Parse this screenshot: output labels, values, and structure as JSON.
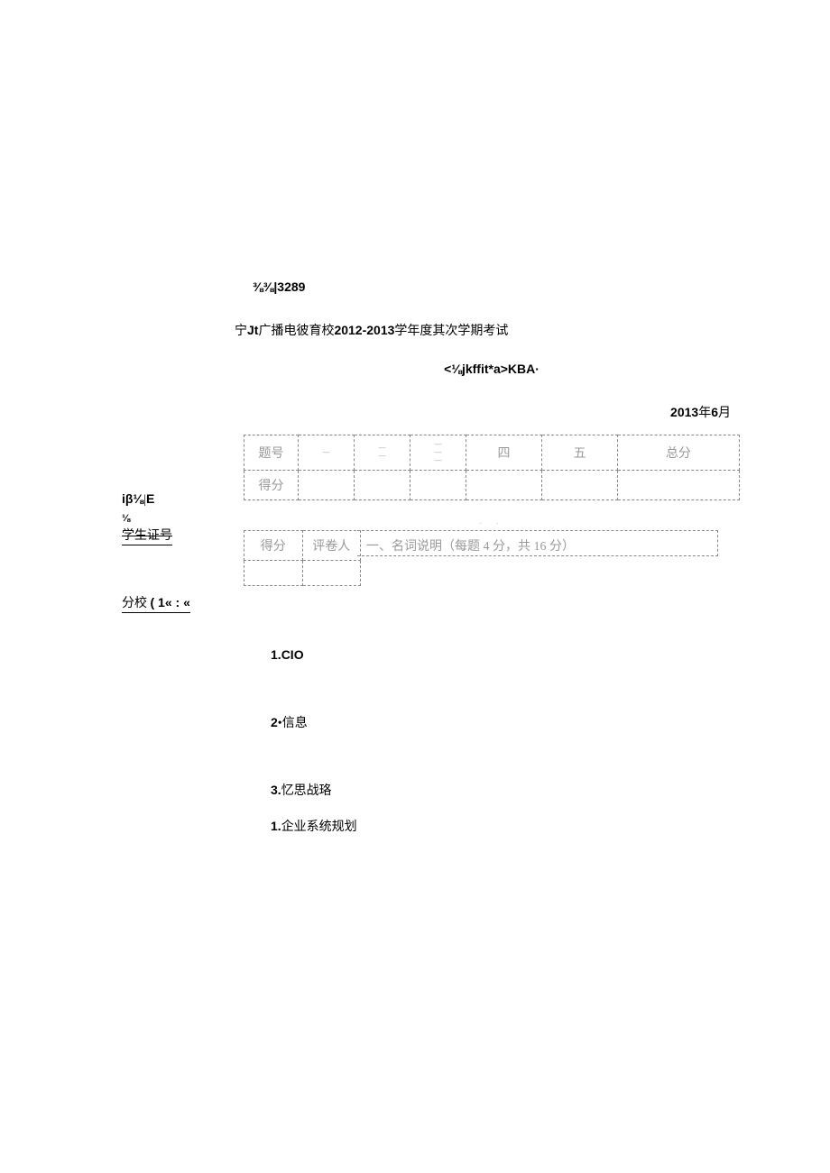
{
  "sidebar": {
    "code_label": "iβ⅛",
    "code_sep": "|",
    "code_suffix": "E",
    "underline_mark": "⅛",
    "student_id_label": "学生证号",
    "branch_label": "分校",
    "branch_paren": "( 1« : «"
  },
  "header": {
    "course_prefix": "⅜⅜",
    "course_sep": "|",
    "course_code": "3289",
    "title_prefix": "宁",
    "title_bold": "Jt",
    "title_mid": "广播电彼育校",
    "title_years": "2012-2013",
    "title_suffix": "学年度其次学期考试",
    "subject": "<⅛jkffit*a>KBA·",
    "date_year": "2013",
    "date_year_cn": "年",
    "date_month": "6",
    "date_month_cn": "月"
  },
  "main_table": {
    "row1_label": "题号",
    "col1": "—",
    "col2_line1": "—",
    "col2_line2": "—",
    "col3_line1": "—",
    "col3_line2": "—",
    "col3_line3": "—",
    "col4": "四",
    "col5": "五",
    "col6": "总分",
    "row2_label": "得分"
  },
  "small_table": {
    "hint": "· ·",
    "cell1": "得分",
    "cell2": "评卷人",
    "section_title": "一、名词说明（每题 4 分，共 16 分）"
  },
  "questions": {
    "q1_num": "1.",
    "q1_text": "CIO",
    "q2_num": "2",
    "q2_dot": "•",
    "q2_text": "信息",
    "q3_num": "3.",
    "q3_text": "忆思战珞",
    "q4_num": "1.",
    "q4_text": "企业系统规划"
  }
}
